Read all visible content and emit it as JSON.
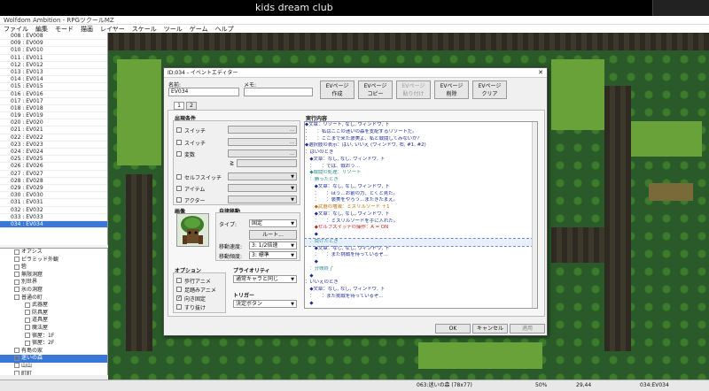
{
  "stream": {
    "title": "kids dream club"
  },
  "window": {
    "title": "Wolfdom Ambition - RPGツクールMZ"
  },
  "menu": [
    "ファイル",
    "編集",
    "モード",
    "描画",
    "レイヤー",
    "スケール",
    "ツール",
    "ゲーム",
    "ヘルプ"
  ],
  "maplist": [
    "008 : EV008",
    "009 : EV009",
    "010 : EV010",
    "011 : EV011",
    "012 : EV012",
    "013 : EV013",
    "014 : EV014",
    "015 : EV015",
    "016 : EV016",
    "017 : EV017",
    "018 : EV018",
    "019 : EV019",
    "020 : EV020",
    "021 : EV021",
    "022 : EV022",
    "023 : EV023",
    "024 : EV024",
    "025 : EV025",
    "026 : EV026",
    "027 : EV027",
    "028 : EV028",
    "029 : EV029",
    "030 : EV030",
    "031 : EV031",
    "032 : EV032",
    "033 : EV033",
    "034 : EV034"
  ],
  "maplist_selected": 26,
  "tree": [
    "オアシス",
    "ピラミッド外観",
    "砦",
    "無限洞窟",
    "別世界",
    "氷の洞窟",
    "普通の町",
    "武器屋",
    "防具屋",
    "道具屋",
    "魔法屋",
    "宿屋：1F",
    "宿屋：2F",
    "有島の家",
    "迷いの森",
    "山山",
    "町町",
    "岩落とし"
  ],
  "tree_selected": 14,
  "status": {
    "map": "063:迷いの森 (78x77)",
    "zoom": "50%",
    "coords": "29,44",
    "event": "034:EV034"
  },
  "dialog": {
    "title": "ID:034 - イベントエディター",
    "name_label": "名前:",
    "name_value": "EV034",
    "memo_label": "メモ:",
    "memo_value": "",
    "buttons": [
      {
        "label": "EVページ\n作成",
        "disabled": false
      },
      {
        "label": "EVページ\nコピー",
        "disabled": false
      },
      {
        "label": "EVページ\n貼り付け",
        "disabled": true
      },
      {
        "label": "EVページ\n削除",
        "disabled": false
      },
      {
        "label": "EVページ\nクリア",
        "disabled": false
      }
    ],
    "tabs": [
      "1",
      "2"
    ],
    "conditions": {
      "title": "出現条件",
      "items": [
        "スイッチ",
        "スイッチ",
        "変数",
        "セルフスイッチ",
        "アイテム",
        "アクター"
      ],
      "var_op": "≧"
    },
    "image_label": "画像",
    "autonomous": {
      "title": "自律移動",
      "type_label": "タイプ:",
      "type_value": "固定",
      "route_button": "ルート...",
      "speed_label": "移動速度:",
      "speed_value": "3: 1/2倍速",
      "freq_label": "移動頻度:",
      "freq_value": "3: 標準"
    },
    "options": {
      "title": "オプション",
      "items": [
        {
          "label": "歩行アニメ",
          "checked": false
        },
        {
          "label": "足踏みアニメ",
          "checked": false
        },
        {
          "label": "向き固定",
          "checked": true
        },
        {
          "label": "すり抜け",
          "checked": false
        }
      ]
    },
    "priority": {
      "title": "プライオリティ",
      "value": "通常キャラと同じ"
    },
    "trigger": {
      "title": "トリガー",
      "value": "決定ボタン"
    },
    "commands_title": "実行内容",
    "commands": [
      {
        "text": "◆文章：リソート, なし, ウィンドウ, 下",
        "color": "#1a2a9a"
      },
      {
        "text": "：　　：私はここの迷いの森を支配するリソートだ。",
        "color": "#1a2a9a"
      },
      {
        "text": "：　　：ここまで来た褒美よ、私と戦闘してみないか？",
        "color": "#1a2a9a"
      },
      {
        "text": "◆選択肢の表示：はい, いいえ (ウィンドウ, 右, #1, #2)",
        "color": "#1a2a9a"
      },
      {
        "text": "：はいのとき",
        "color": "#1a2a9a"
      },
      {
        "text": "　◆文章：なし, なし, ウィンドウ, 下",
        "color": "#1a2a9a"
      },
      {
        "text": "　：　　：では、戦おう…",
        "color": "#1a2a9a"
      },
      {
        "text": "　◆戦闘の処理：リソート",
        "color": "#2a8a8a"
      },
      {
        "text": "　：勝ったとき",
        "color": "#2a8a8a"
      },
      {
        "text": "　　◆文章：なし, なし, ウィンドウ, 下",
        "color": "#1a2a9a"
      },
      {
        "text": "　　：　　：ほう…お前の力、とくと見た。",
        "color": "#1a2a9a"
      },
      {
        "text": "　　：　　：褒美をやろう…またきたまえ。",
        "color": "#1a2a9a"
      },
      {
        "text": "　　◆武器の増減：ミスリルソード ＋1",
        "color": "#c86a00"
      },
      {
        "text": "　　◆文章：なし, なし, ウィンドウ, 下",
        "color": "#1a2a9a"
      },
      {
        "text": "　　：　　：ミスリルソードを手に入れた。",
        "color": "#1a2a9a"
      },
      {
        "text": "　　◆セルフスイッチの操作：A = ON",
        "color": "#c82020"
      },
      {
        "text": "　　◆",
        "color": "#1a2a9a"
      },
      {
        "text": "　：負けたとき",
        "color": "#2a8a8a"
      },
      {
        "text": "　　◆文章：なし, なし, ウィンドウ, 下",
        "color": "#1a2a9a"
      },
      {
        "text": "　　：　　：また挑戦を待っているぞ…",
        "color": "#1a2a9a"
      },
      {
        "text": "　　◆",
        "color": "#1a2a9a"
      },
      {
        "text": "　：分岐終了",
        "color": "#2a8a8a"
      },
      {
        "text": "　◆",
        "color": "#1a2a9a"
      },
      {
        "text": "：いいえのとき",
        "color": "#1a2a9a"
      },
      {
        "text": "　◆文章：なし, なし, ウィンドウ, 下",
        "color": "#1a2a9a"
      },
      {
        "text": "　：　　：また挑戦を待っているぞ…",
        "color": "#1a2a9a"
      },
      {
        "text": "　◆",
        "color": "#1a2a9a"
      }
    ],
    "highlight_row": 17,
    "ok": "OK",
    "cancel": "キャンセル",
    "apply": "適用"
  }
}
